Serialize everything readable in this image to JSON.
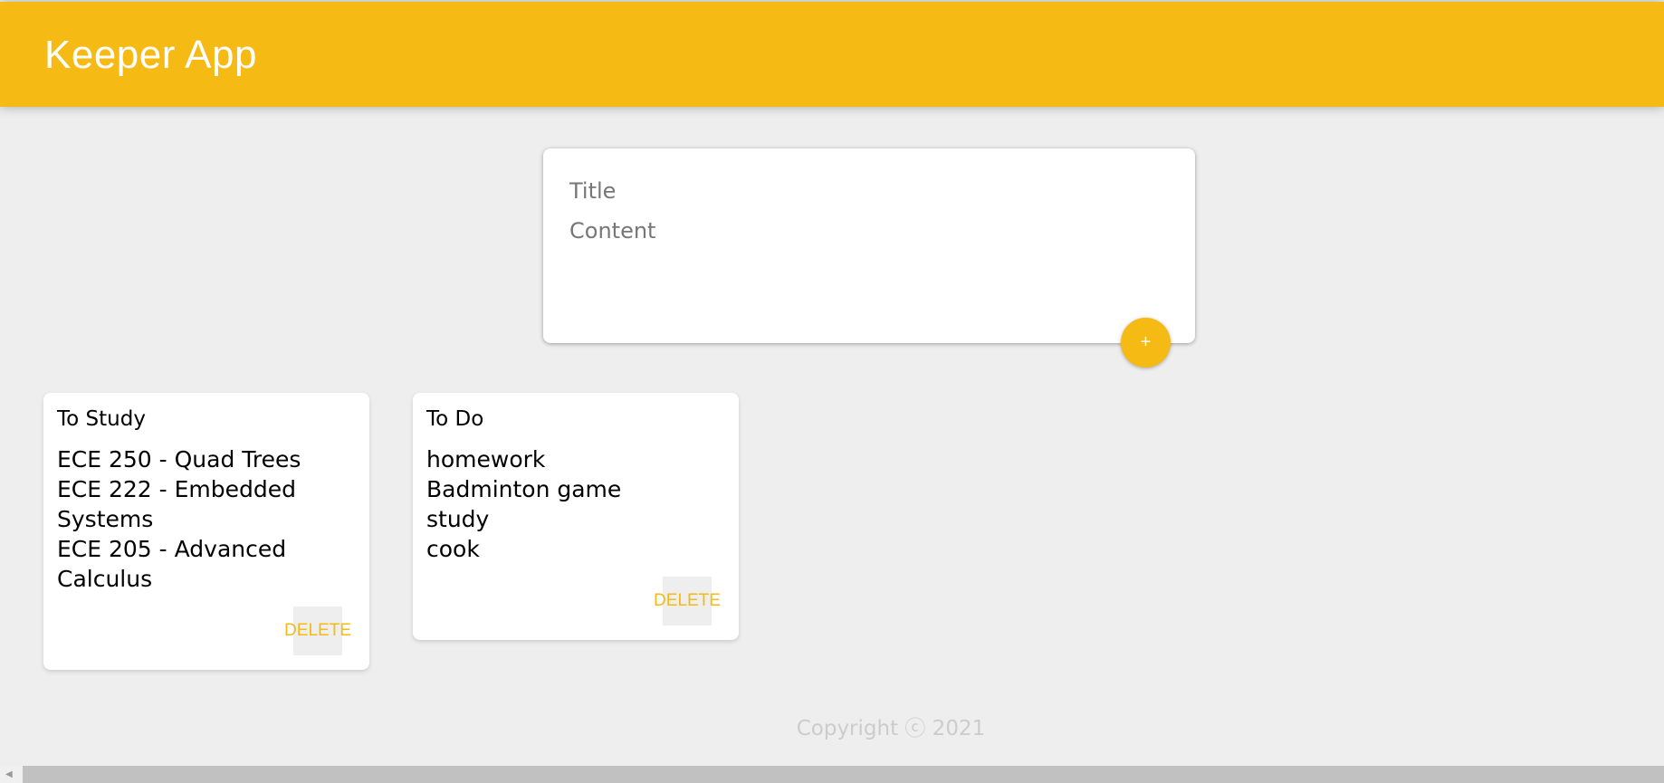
{
  "header": {
    "title": "Keeper App"
  },
  "create_area": {
    "title_placeholder": "Title",
    "content_placeholder": "Content",
    "add_label": "+"
  },
  "notes": [
    {
      "title": "To Study",
      "content": "ECE 250 - Quad Trees\nECE 222 - Embedded Systems\nECE 205 - Advanced Calculus",
      "delete_label": "DELETE"
    },
    {
      "title": "To Do",
      "content": "homework\nBadminton game\nstudy\ncook",
      "delete_label": "DELETE"
    }
  ],
  "footer": {
    "text": "Copyright ⓒ 2021"
  },
  "colors": {
    "accent": "#f5ba13",
    "background": "#eeeeee"
  }
}
